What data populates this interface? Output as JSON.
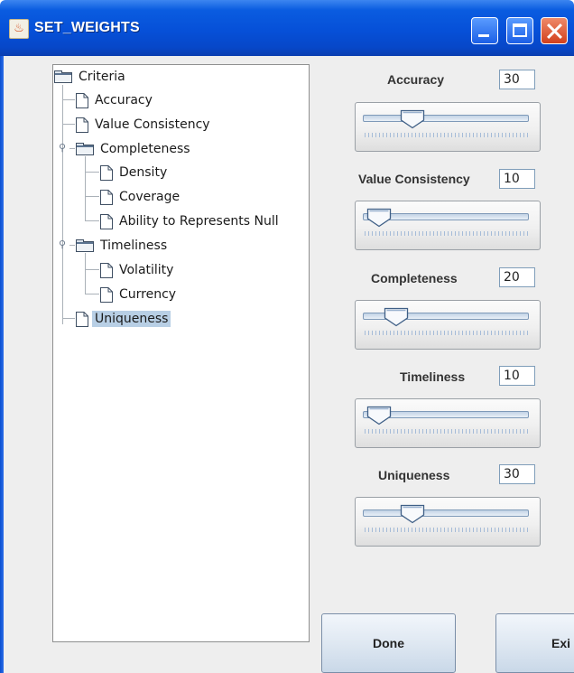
{
  "window": {
    "title": "SET_WEIGHTS"
  },
  "tree": {
    "root": "Criteria",
    "items": [
      {
        "label": "Accuracy"
      },
      {
        "label": "Value Consistency"
      },
      {
        "label": "Completeness",
        "children": [
          "Density",
          "Coverage",
          "Ability to Represents Null"
        ]
      },
      {
        "label": "Timeliness",
        "children": [
          "Volatility",
          "Currency"
        ]
      },
      {
        "label": "Uniqueness",
        "selected": true
      }
    ]
  },
  "weights": [
    {
      "label": "Accuracy",
      "value": "30",
      "slider_fraction": 0.3
    },
    {
      "label": "Value Consistency",
      "value": "10",
      "slider_fraction": 0.1
    },
    {
      "label": "Completeness",
      "value": "20",
      "slider_fraction": 0.2
    },
    {
      "label": "Timeliness",
      "value": "10",
      "slider_fraction": 0.1
    },
    {
      "label": "Uniqueness",
      "value": "30",
      "slider_fraction": 0.3
    }
  ],
  "buttons": {
    "done": "Done",
    "exit": "Exi"
  }
}
